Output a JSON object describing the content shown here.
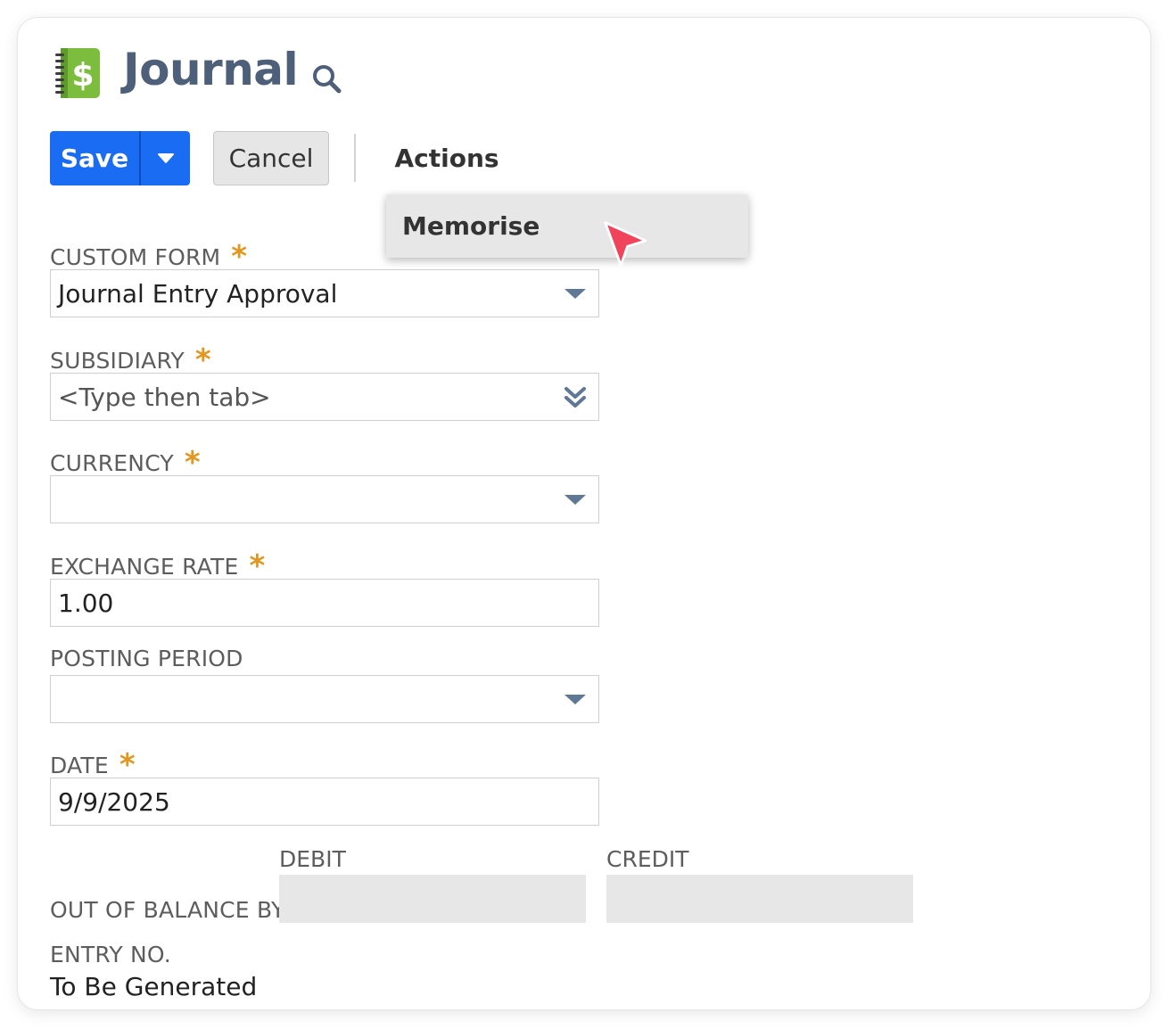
{
  "header": {
    "title": "Journal",
    "icon": "ledger-dollar-icon",
    "search_icon": "search-icon"
  },
  "toolbar": {
    "save_label": "Save",
    "cancel_label": "Cancel",
    "actions_label": "Actions"
  },
  "actions_menu": {
    "items": [
      {
        "label": "Memorise"
      }
    ]
  },
  "form": {
    "custom_form": {
      "label": "CUSTOM FORM",
      "required": true,
      "value": "Journal Entry Approval"
    },
    "subsidiary": {
      "label": "SUBSIDIARY",
      "required": true,
      "placeholder": "<Type then tab>"
    },
    "currency": {
      "label": "CURRENCY",
      "required": true,
      "value": ""
    },
    "exchange_rate": {
      "label": "EXCHANGE RATE",
      "required": true,
      "value": "1.00"
    },
    "posting_period": {
      "label": "POSTING PERIOD",
      "required": false,
      "value": ""
    },
    "date": {
      "label": "DATE",
      "required": true,
      "value": "9/9/2025"
    }
  },
  "balance": {
    "label": "OUT OF BALANCE BY",
    "debit_header": "DEBIT",
    "credit_header": "CREDIT",
    "debit_value": "",
    "credit_value": ""
  },
  "entry_no": {
    "label": "ENTRY NO.",
    "value": "To Be Generated"
  },
  "required_marker": "*",
  "colors": {
    "primary": "#1a6cf2",
    "title": "#4d5f79",
    "required": "#e29720",
    "icon_green": "#7cbd3e",
    "cursor": "#f0435c"
  }
}
